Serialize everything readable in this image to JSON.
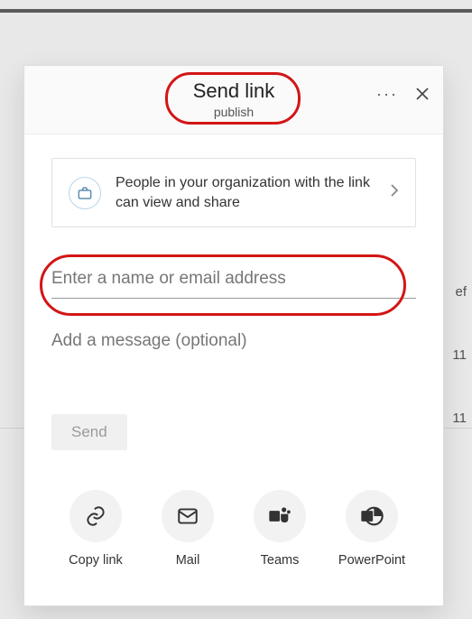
{
  "background": {
    "truncated_header": "ef",
    "row2": "11",
    "row3": "11"
  },
  "dialog": {
    "title": "Send link",
    "subtitle": "publish",
    "more_label": "More options",
    "close_label": "Close",
    "permission": {
      "text": "People in your organization with the link can view and share",
      "icon": "briefcase-icon"
    },
    "recipient_placeholder": "Enter a name or email address",
    "message_placeholder": "Add a message (optional)",
    "send_label": "Send",
    "share_targets": [
      {
        "id": "copy-link",
        "label": "Copy link",
        "icon": "link-icon"
      },
      {
        "id": "mail",
        "label": "Mail",
        "icon": "mail-icon"
      },
      {
        "id": "teams",
        "label": "Teams",
        "icon": "teams-icon"
      },
      {
        "id": "powerpoint",
        "label": "PowerPoint",
        "icon": "powerpoint-icon"
      }
    ]
  }
}
